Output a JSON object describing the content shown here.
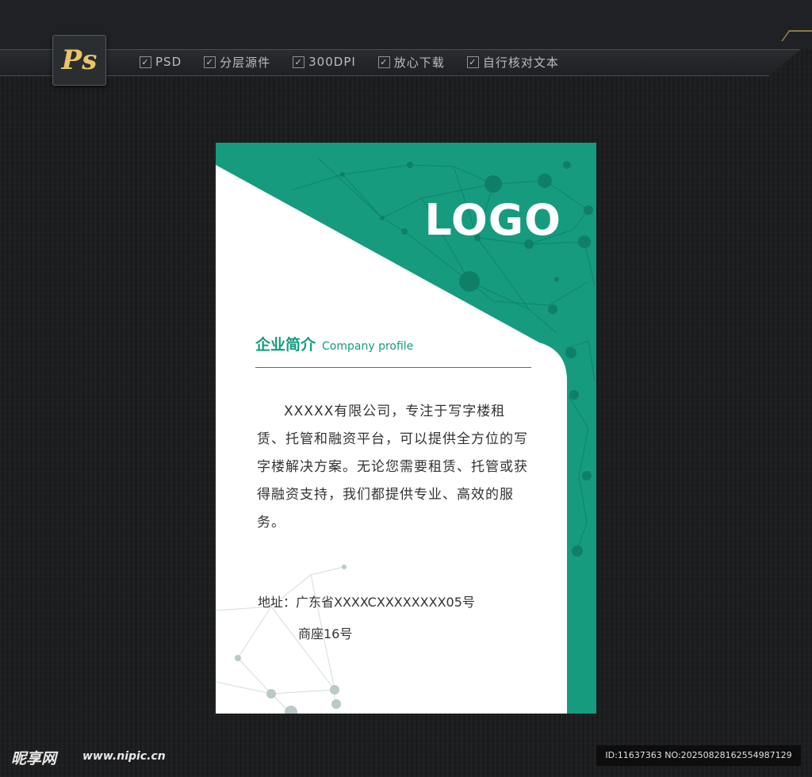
{
  "header": {
    "badge_label": "Ps",
    "features": [
      "PSD",
      "分层源件",
      "300DPI",
      "放心下载",
      "自行核对文本"
    ]
  },
  "card": {
    "logo": "LOGO",
    "profile_title_cn": "企业简介",
    "profile_title_en": "Company profile",
    "description": "XXXXX有限公司，专注于写字楼租赁、托管和融资平台，可以提供全方位的写字楼解决方案。无论您需要租赁、托管或获得融资支持，我们都提供专业、高效的服务。",
    "address_line1": "地址：广东省XXXXCXXXXXXXX05号",
    "address_line2": "商座16号"
  },
  "watermark": {
    "site_logo": "昵享网",
    "site_url": "www.nipic.cn",
    "id_text": "ID:11637363 NO:20250828162554987129"
  },
  "colors": {
    "accent": "#169b7f",
    "background": "#1c1d1f",
    "badge_text": "#e9c46a"
  }
}
